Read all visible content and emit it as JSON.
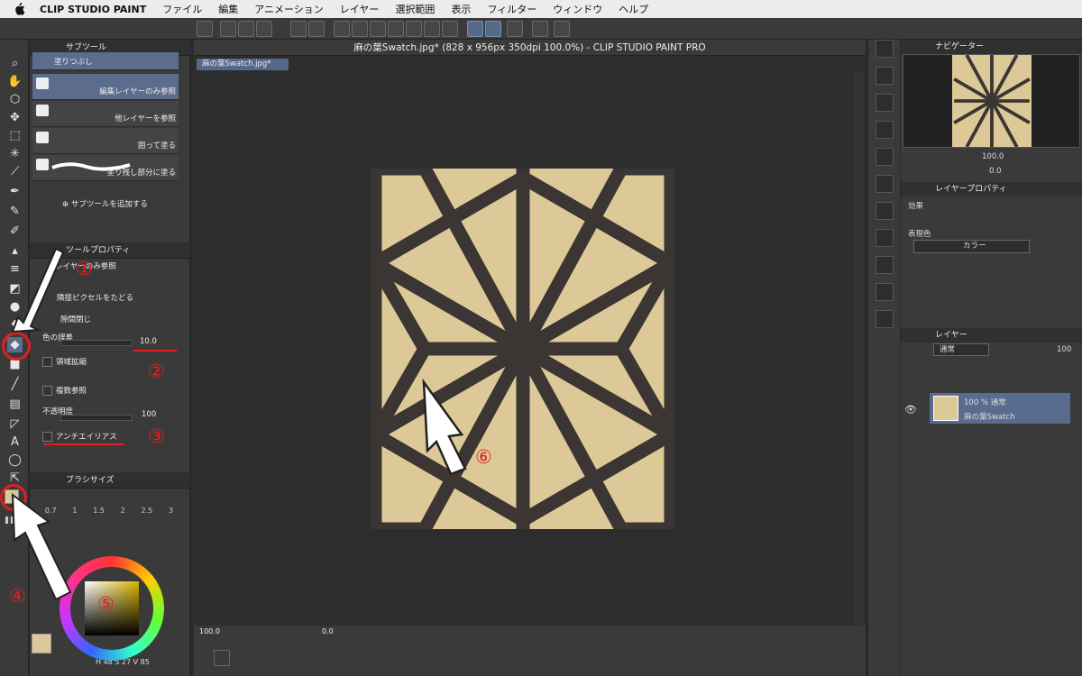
{
  "menubar": {
    "app_name": "CLIP STUDIO PAINT",
    "items": [
      "ファイル",
      "編集",
      "アニメーション",
      "レイヤー",
      "選択範囲",
      "表示",
      "フィルター",
      "ウィンドウ",
      "ヘルプ"
    ]
  },
  "subtool": {
    "title": "サブツール",
    "items": [
      {
        "label": "塗りつぶし"
      },
      {
        "label": "編集レイヤーのみ参照"
      },
      {
        "label": "他レイヤーを参照"
      },
      {
        "label": "囲って塗る"
      },
      {
        "label": "塗り残し部分に塗る"
      }
    ],
    "add_label": "サブツールを追加する"
  },
  "tool_property": {
    "title": "ツールプロパティ",
    "header": "レイヤーのみ参照",
    "adjacent_label": "隣接ピクセルをたどる",
    "gap_close_label": "隙間閉じ",
    "color_margin_label": "色の誤差",
    "color_margin_value": "10.0",
    "area_scaling_label": "領域拡縮",
    "multi_ref_label": "複数参照",
    "opacity_label": "不透明度",
    "opacity_value": "100",
    "antialias_label": "アンチエイリアス"
  },
  "brush_size": {
    "title": "ブラシサイズ",
    "sizes": [
      "0.7",
      "1",
      "1.5",
      "2",
      "2.5",
      "3"
    ]
  },
  "color": {
    "main_color": "#ddc998",
    "accent": "#556a8a",
    "hsv": {
      "h": "48",
      "s": "27",
      "v": "85"
    }
  },
  "document": {
    "title": "麻の葉Swatch.jpg* (828 x 956px 350dpi 100.0%)  - CLIP STUDIO PAINT PRO",
    "tab": "麻の葉Swatch.jpg*",
    "zoom": "100.0",
    "rotation": "0.0"
  },
  "canvas_colors": {
    "paper": "#ddc998",
    "lines": "#3b3533"
  },
  "navigator": {
    "title": "ナビゲーター",
    "zoom": "100.0",
    "rotation": "0.0"
  },
  "layer_property": {
    "title": "レイヤープロパティ",
    "effect_label": "効果",
    "expression_label": "表現色",
    "expression_value": "カラー"
  },
  "layers": {
    "title": "レイヤー",
    "blend_mode": "通常",
    "opacity": "100",
    "items": [
      {
        "opacity_mode": "100 % 通常",
        "name": "麻の葉Swatch"
      }
    ]
  },
  "annotations": [
    "①",
    "②",
    "③",
    "④",
    "⑤",
    "⑥"
  ]
}
